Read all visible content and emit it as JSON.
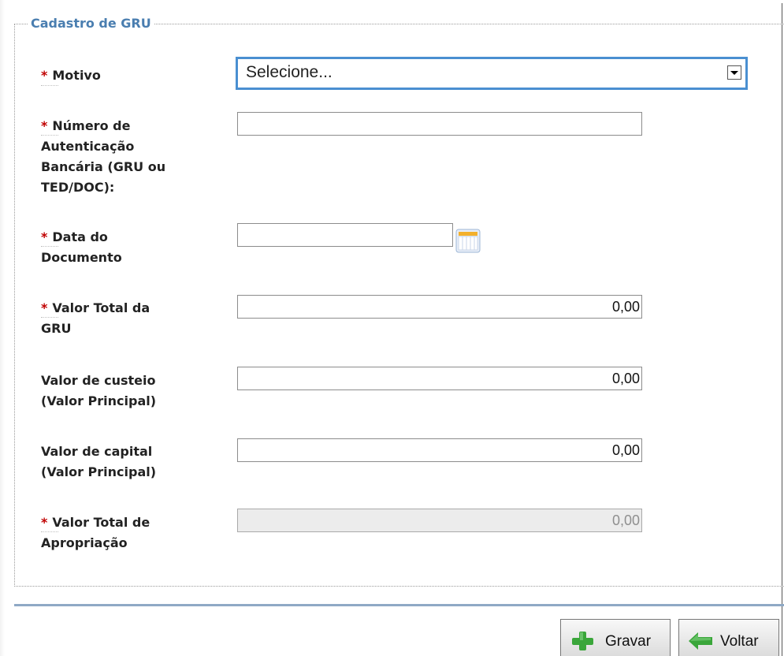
{
  "form": {
    "legend": "Cadastro de GRU",
    "required_marker": "*",
    "fields": [
      {
        "label": "Motivo",
        "required": true
      },
      {
        "label_lines": [
          "Número de",
          "Autenticação",
          "Bancária (GRU ou",
          "TED/DOC):"
        ],
        "required": true,
        "value": ""
      },
      {
        "label_lines": [
          "Data do",
          "Documento"
        ],
        "required": true,
        "value": ""
      },
      {
        "label_lines": [
          "Valor Total da",
          "GRU"
        ],
        "required": true,
        "value": "0,00"
      },
      {
        "label_lines": [
          "Valor de custeio",
          "(Valor Principal)"
        ],
        "required": false,
        "value": "0,00"
      },
      {
        "label_lines": [
          "Valor de capital",
          "(Valor Principal)"
        ],
        "required": false,
        "value": "0,00"
      },
      {
        "label_lines": [
          "Valor Total de",
          "Apropriação"
        ],
        "required": true,
        "value": "0,00",
        "disabled": true
      }
    ],
    "motivo_select": {
      "selected": "Selecione..."
    }
  },
  "actions": {
    "save_label": "Gravar",
    "back_label": "Voltar"
  },
  "icons": {
    "calendar": "calendar-icon",
    "plus": "plus-icon",
    "back": "arrow-left-icon",
    "select_arrow": "chevron-down-icon"
  },
  "colors": {
    "legend": "#4a7eb0",
    "required": "#c00000",
    "select_border": "#4a8fd1",
    "plus_green": "#3aa63a"
  }
}
